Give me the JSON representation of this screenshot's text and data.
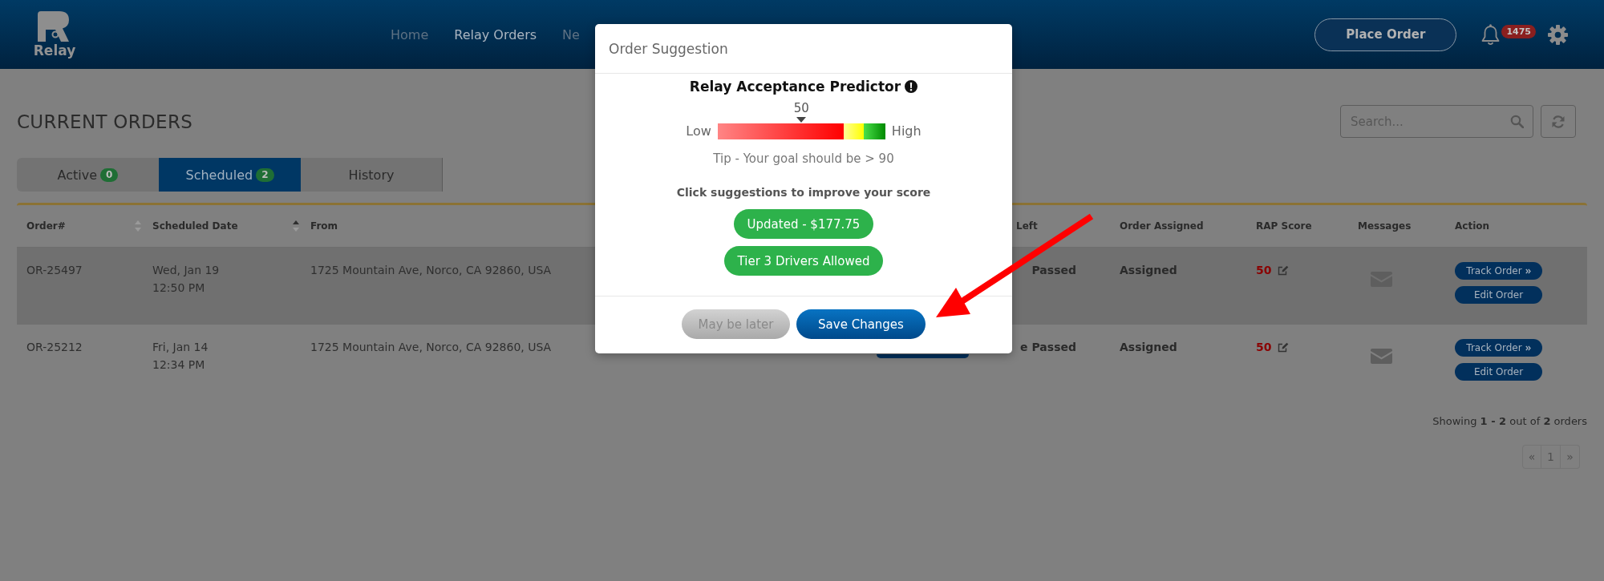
{
  "header": {
    "logo_text": "Relay",
    "nav": [
      {
        "label": "Home",
        "selected": false
      },
      {
        "label": "Relay Orders",
        "selected": true
      },
      {
        "label": "Ne",
        "selected": false
      }
    ],
    "place_order": "Place Order",
    "notification_count": "1475"
  },
  "page": {
    "title": "CURRENT ORDERS",
    "search": {
      "placeholder": "Search..."
    }
  },
  "tabs": [
    {
      "label": "Active",
      "count": "0",
      "selected": false
    },
    {
      "label": "Scheduled",
      "count": "2",
      "selected": true
    },
    {
      "label": "History",
      "selected": false
    }
  ],
  "table": {
    "columns": {
      "order_no": {
        "label": "Order#",
        "sorted": false
      },
      "scheduled_date": {
        "label": "Scheduled Date",
        "sorted": true
      },
      "from": {
        "label": "From"
      },
      "column_6": {
        "label": "Left"
      },
      "order_assigned": {
        "label": "Order Assigned"
      },
      "rap_score": {
        "label": "RAP Score"
      },
      "messages": {
        "label": "Messages"
      },
      "action": {
        "label": "Action"
      }
    },
    "rows": [
      {
        "highlighted": true,
        "order_no": "OR-25497",
        "scheduled_date": "Wed, Jan 19",
        "scheduled_time": "12:50 PM",
        "from": "1725 Mountain Ave, Norco, CA 92860, USA",
        "column_6": "Passed",
        "order_assigned": "Assigned",
        "rap_score": "50",
        "actions": [
          {
            "label": "Track Order",
            "kind": "track"
          },
          {
            "label": "Edit Order",
            "kind": "edit"
          }
        ]
      },
      {
        "highlighted": false,
        "order_no": "OR-25212",
        "scheduled_date": "Fri, Jan 14",
        "scheduled_time": "12:34 PM",
        "from": "1725 Mountain Ave, Norco, CA 92860, USA",
        "column_5": {
          "kind": "button"
        },
        "column_6": "e Passed",
        "order_assigned": "Assigned",
        "rap_score": "50",
        "actions": [
          {
            "label": "Track Order",
            "kind": "track"
          },
          {
            "label": "Edit Order",
            "kind": "edit"
          }
        ]
      }
    ],
    "summary": "Showing **1 - 2** out of **2** orders",
    "pagination": [
      "«",
      "1",
      "»"
    ]
  },
  "modal": {
    "title": "Order Suggestion",
    "heading": "Relay Acceptance Predictor",
    "score": {
      "reading": "50",
      "level": 0.5,
      "low_label": "Low",
      "high_label": "High"
    },
    "tip": "Tip - Your goal should be > 90",
    "prompt": "Click suggestions to improve your score",
    "suggestions": [
      "Updated - $177.75",
      "Tier 3 Drivers Allowed"
    ],
    "buttons": [
      {
        "label": "May be later",
        "kind": "secondary"
      },
      {
        "label": "Save Changes",
        "kind": "primary"
      }
    ]
  }
}
